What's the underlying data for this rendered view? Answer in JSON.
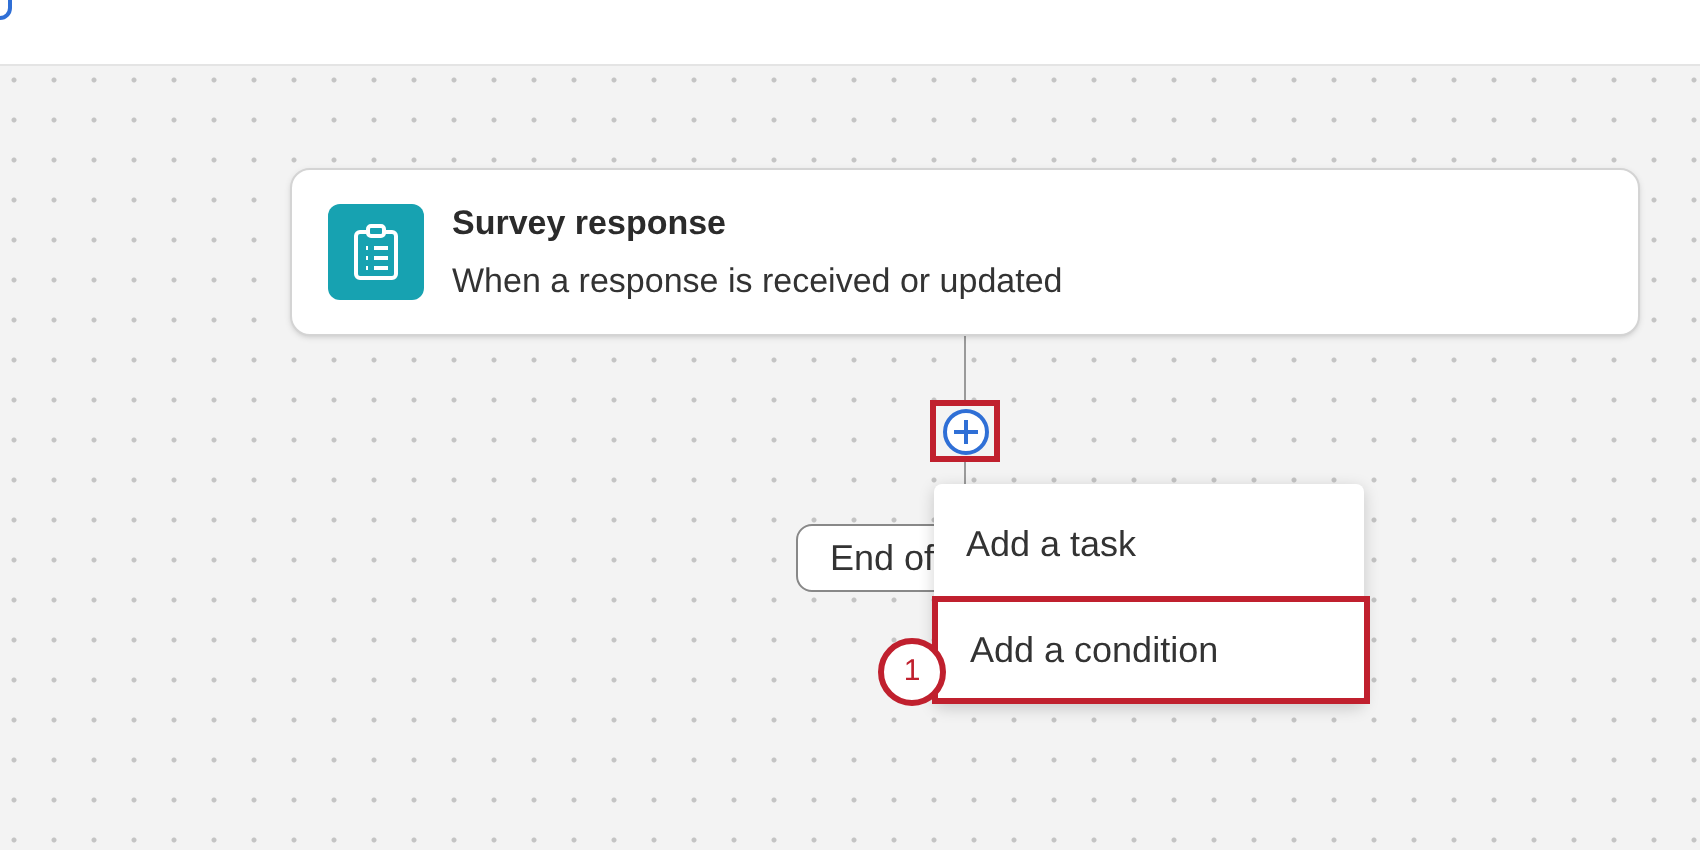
{
  "trigger": {
    "title": "Survey response",
    "subtitle": "When a response is received or updated"
  },
  "add_step": {
    "highlighted": true
  },
  "end_node": {
    "label": "End of"
  },
  "menu": [
    {
      "label": "Add a task",
      "selected": false
    },
    {
      "label": "Add a condition",
      "selected": true
    }
  ],
  "callout": "1"
}
